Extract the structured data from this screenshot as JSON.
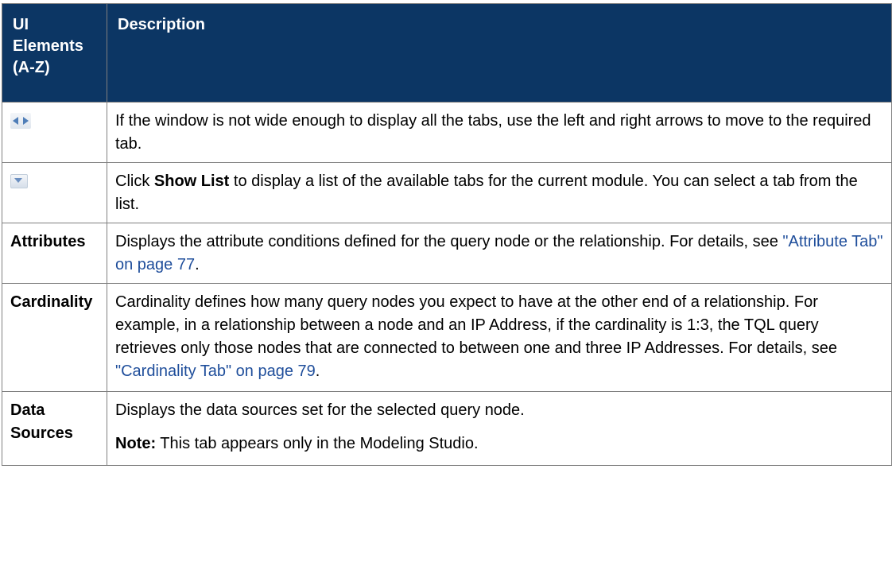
{
  "table": {
    "headers": {
      "ui_elements": "UI Elements (A-Z)",
      "description": "Description"
    },
    "rows": {
      "arrows": {
        "icon": "left-right-arrows-icon",
        "description": "If the window is not wide enough to display all the tabs, use the left and right arrows to move to the required tab."
      },
      "show_list": {
        "icon": "dropdown-arrow-icon",
        "desc_prefix": "Click ",
        "desc_bold": "Show List",
        "desc_suffix": " to display a list of the available tabs for the current module. You can select a tab from the list."
      },
      "attributes": {
        "name": "Attributes",
        "desc_text": "Displays the attribute conditions defined for the query node or the relationship. For details, see ",
        "link": "\"Attribute Tab\" on page 77",
        "desc_end": "."
      },
      "cardinality": {
        "name": "Cardinality",
        "desc_text": "Cardinality defines how many query nodes you expect to have at the other end of a relationship. For example, in a relationship between a node and an IP Address, if the cardinality is 1:3, the TQL query retrieves only those nodes that are connected to between one and three IP Addresses. For details, see ",
        "link": "\"Cardinality Tab\" on page 79",
        "desc_end": "."
      },
      "data_sources": {
        "name": "Data Sources",
        "desc_text": "Displays the data sources set for the selected query node.",
        "note_label": "Note:",
        "note_text": " This tab appears only in the Modeling Studio."
      }
    }
  },
  "colors": {
    "header_bg": "#0c3664",
    "header_text": "#ffffff",
    "link": "#1f4e9b",
    "border": "#7f7f7f"
  }
}
